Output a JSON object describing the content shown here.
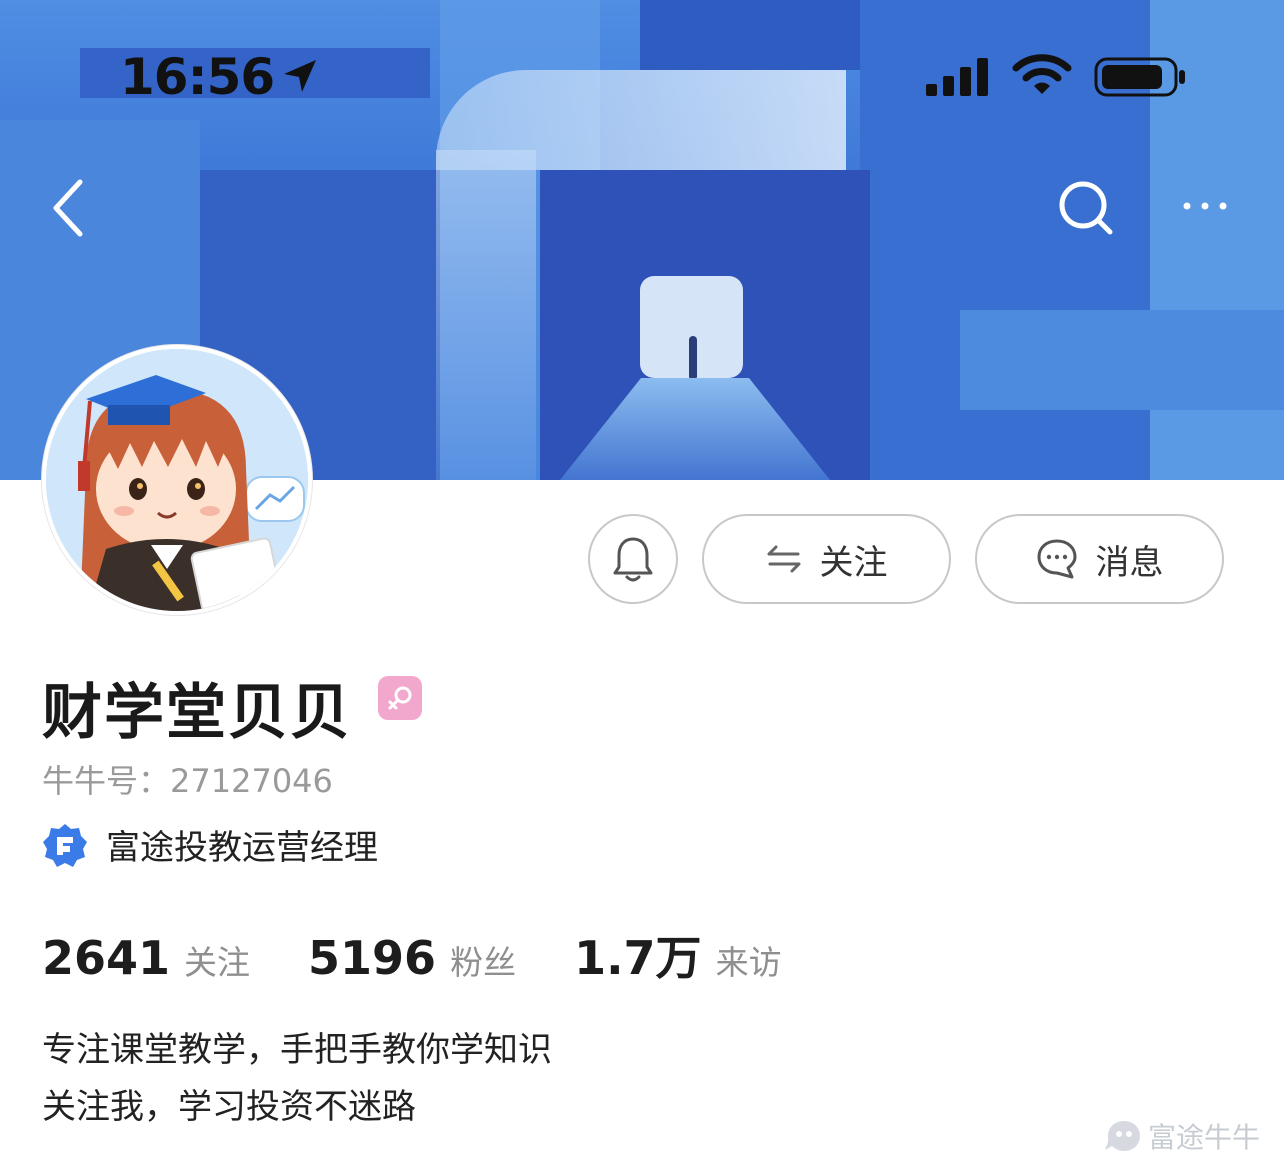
{
  "status_bar": {
    "time": "16:56"
  },
  "profile": {
    "name": "财学堂贝贝",
    "id_label": "牛牛号：",
    "id_value": "27127046",
    "verification": "富途投教运营经理"
  },
  "actions": {
    "follow_label": "关注",
    "message_label": "消息"
  },
  "stats": [
    {
      "value": "2641",
      "label": "关注"
    },
    {
      "value": "5196",
      "label": "粉丝"
    },
    {
      "value": "1.7万",
      "label": "来访"
    }
  ],
  "bio": {
    "line1": "专注课堂教学，手把手教你学知识",
    "line2": "关注我，学习投资不迷路"
  },
  "watermark": "富途牛牛",
  "colors": {
    "banner": "#3b74d6",
    "verify_badge": "#3a7be8",
    "gender_badge": "#f2a8cc"
  }
}
